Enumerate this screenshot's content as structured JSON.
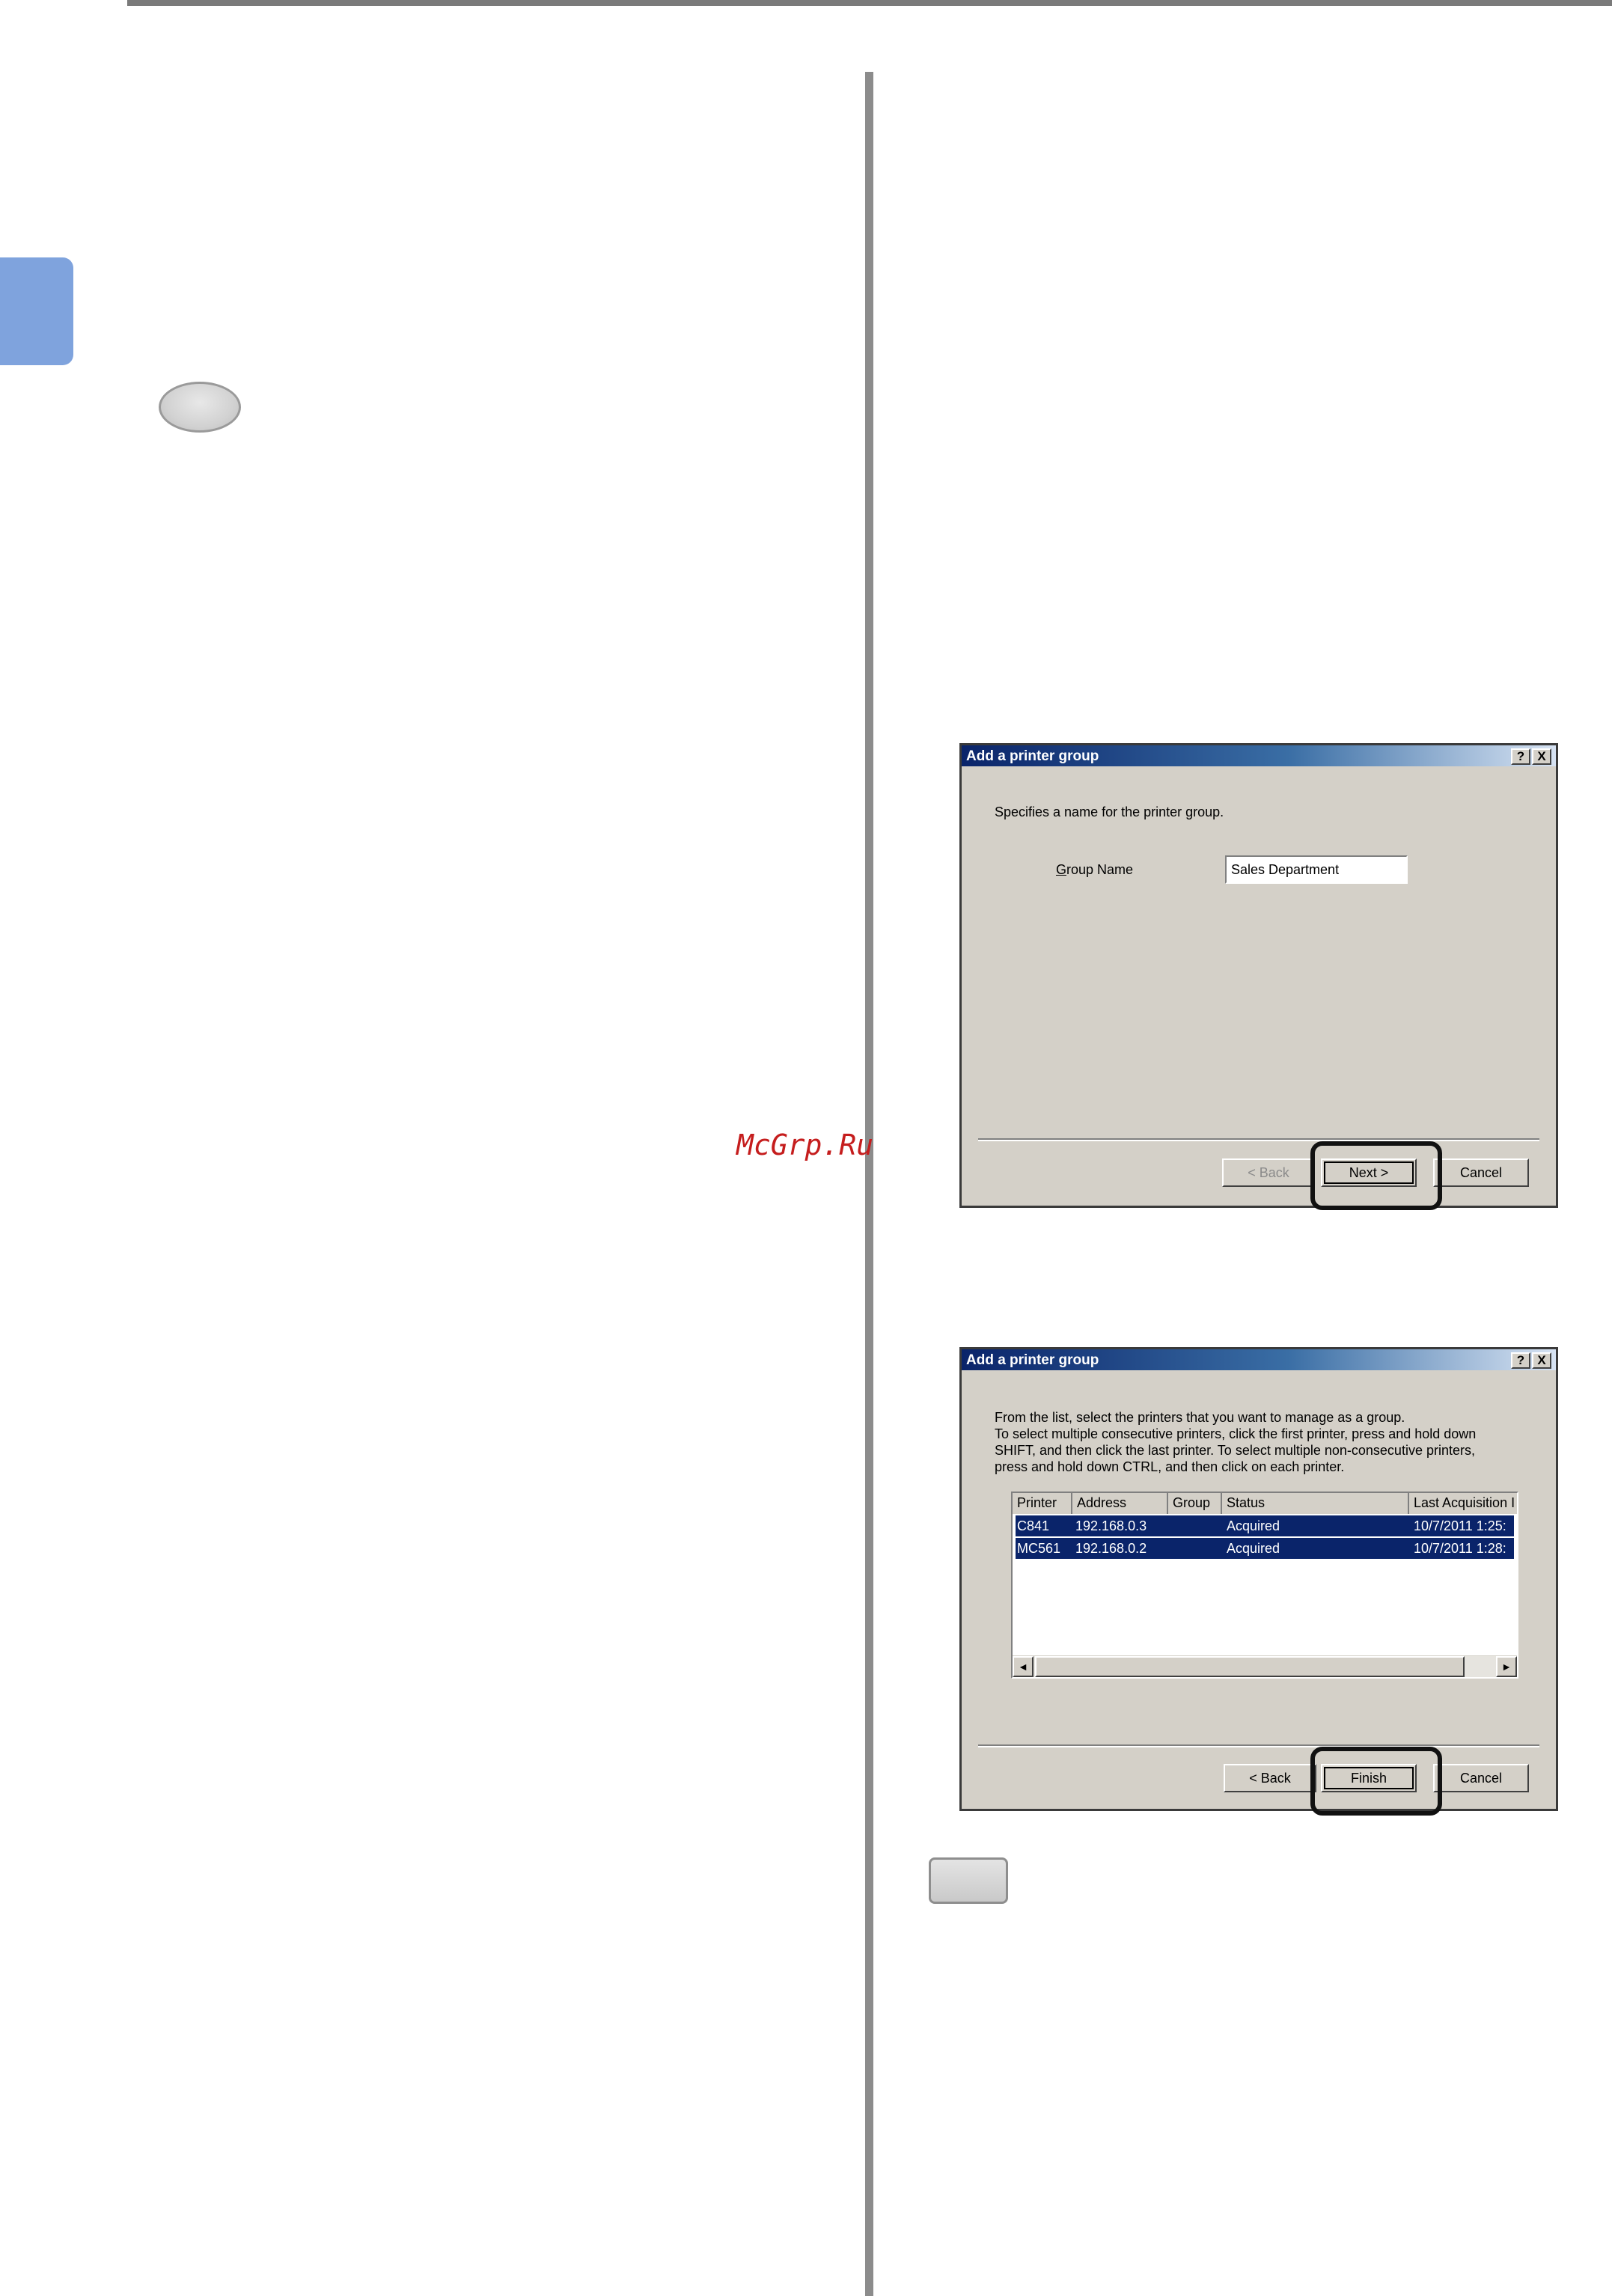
{
  "watermark": "McGrp.Ru",
  "dialog_group_name": {
    "title": "Add a printer group",
    "help_label": "?",
    "close_label": "X",
    "prompt": "Specifies a name for the printer group.",
    "field_label_accel": "G",
    "field_label_rest": "roup Name",
    "field_value": "Sales Department",
    "back_label": "< Back",
    "next_label": "Next >",
    "cancel_label": "Cancel",
    "back_enabled": false
  },
  "dialog_select_printers": {
    "title": "Add a printer group",
    "help_label": "?",
    "close_label": "X",
    "prompt_lines": [
      "From the list, select the printers that you want to manage as a group.",
      "To select multiple consecutive printers, click the first printer, press and hold down",
      "SHIFT, and then click the last printer. To select multiple non-consecutive printers,",
      "press and hold down CTRL, and then click on each printer."
    ],
    "columns": [
      "Printer",
      "Address",
      "Group",
      "Status",
      "Last Acquisition I"
    ],
    "rows": [
      {
        "printer": "C841",
        "address": "192.168.0.3",
        "group": "",
        "status": "Acquired",
        "last": "10/7/2011 1:25:"
      },
      {
        "printer": "MC561",
        "address": "192.168.0.2",
        "group": "",
        "status": "Acquired",
        "last": "10/7/2011 1:28:"
      }
    ],
    "scroll_left": "◄",
    "scroll_right": "►",
    "back_label": "< Back",
    "finish_label": "Finish",
    "cancel_label": "Cancel"
  },
  "icons": [
    "help-icon",
    "close-icon",
    "scroll-left-icon",
    "scroll-right-icon"
  ],
  "colors": {
    "titlebar": "#0a246a",
    "dialog_face": "#d4d0c8",
    "selection": "#0a246a",
    "side_tab": "#7fa3dd",
    "watermark": "#c51d1d"
  }
}
